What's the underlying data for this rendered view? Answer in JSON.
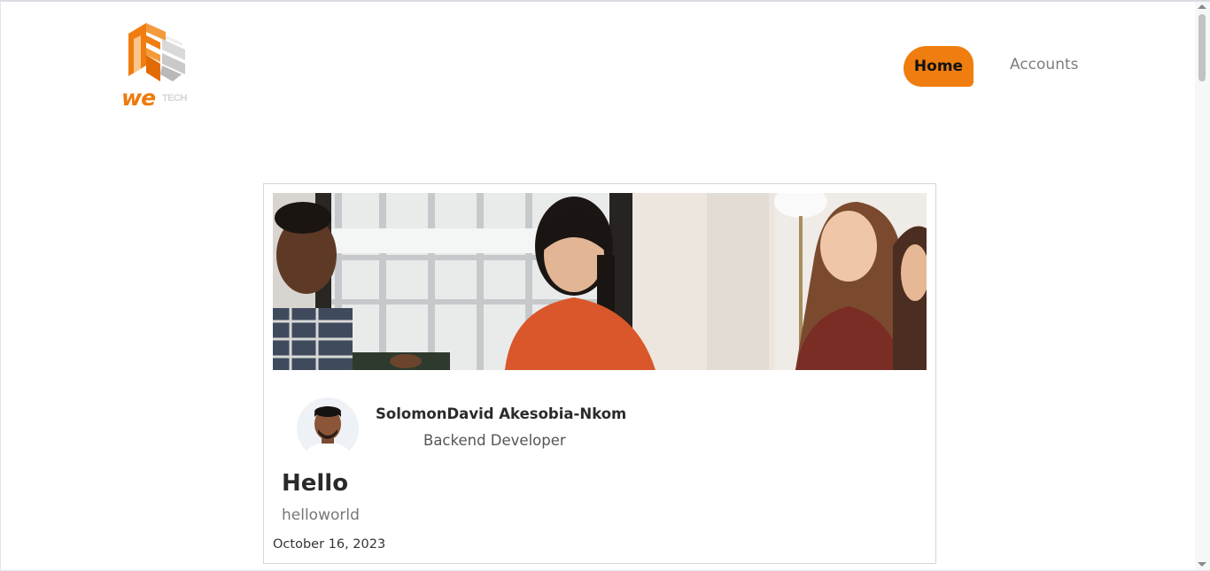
{
  "brand": {
    "logo_word": "we",
    "logo_sub": "TECH",
    "accent_color": "#ef7d0f"
  },
  "nav": {
    "home_label": "Home",
    "accounts_label": "Accounts"
  },
  "post": {
    "author_name": "SolomonDavid Akesobia-Nkom",
    "author_role": "Backend Developer",
    "title": "Hello",
    "body": "helloworld",
    "date": "October 16, 2023"
  },
  "icons": {
    "logo": "wetech-cube-logo",
    "avatar": "author-avatar",
    "banner": "team-photo-banner"
  }
}
